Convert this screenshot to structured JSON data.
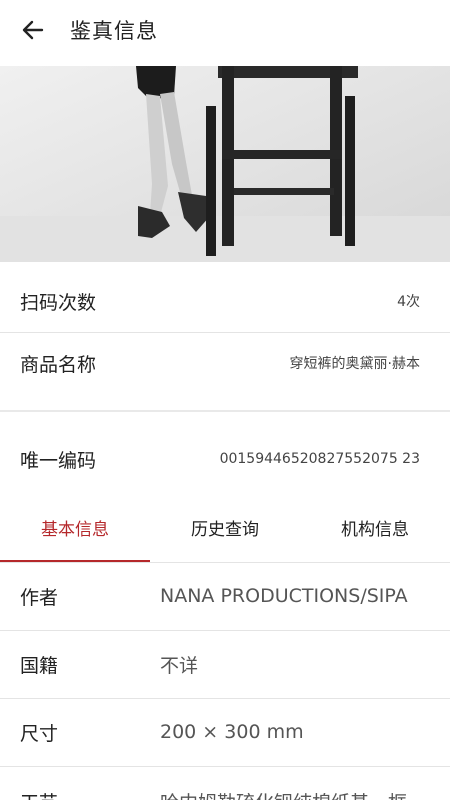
{
  "header": {
    "title": "鉴真信息",
    "back_icon": "arrow-left-icon"
  },
  "photo": {
    "description_icon": "photo"
  },
  "summary": [
    {
      "label": "扫码次数",
      "value": "4次"
    },
    {
      "label": "商品名称",
      "value": "穿短裤的奥黛丽·赫本"
    },
    {
      "label": "唯一编码",
      "value": "00159446520827552075 23"
    }
  ],
  "tabs": [
    {
      "label": "基本信息",
      "active": true
    },
    {
      "label": "历史查询",
      "active": false
    },
    {
      "label": "机构信息",
      "active": false
    }
  ],
  "details": [
    {
      "label": "作者",
      "value": "NANA PRODUCTIONS/SIPA"
    },
    {
      "label": "国籍",
      "value": "不详"
    },
    {
      "label": "尺寸",
      "value": "200 × 300 mm"
    },
    {
      "label": "工艺",
      "value": "哈内姆勒硫化钡纯棉纸基，框"
    }
  ],
  "colors": {
    "accent": "#b5282b"
  }
}
